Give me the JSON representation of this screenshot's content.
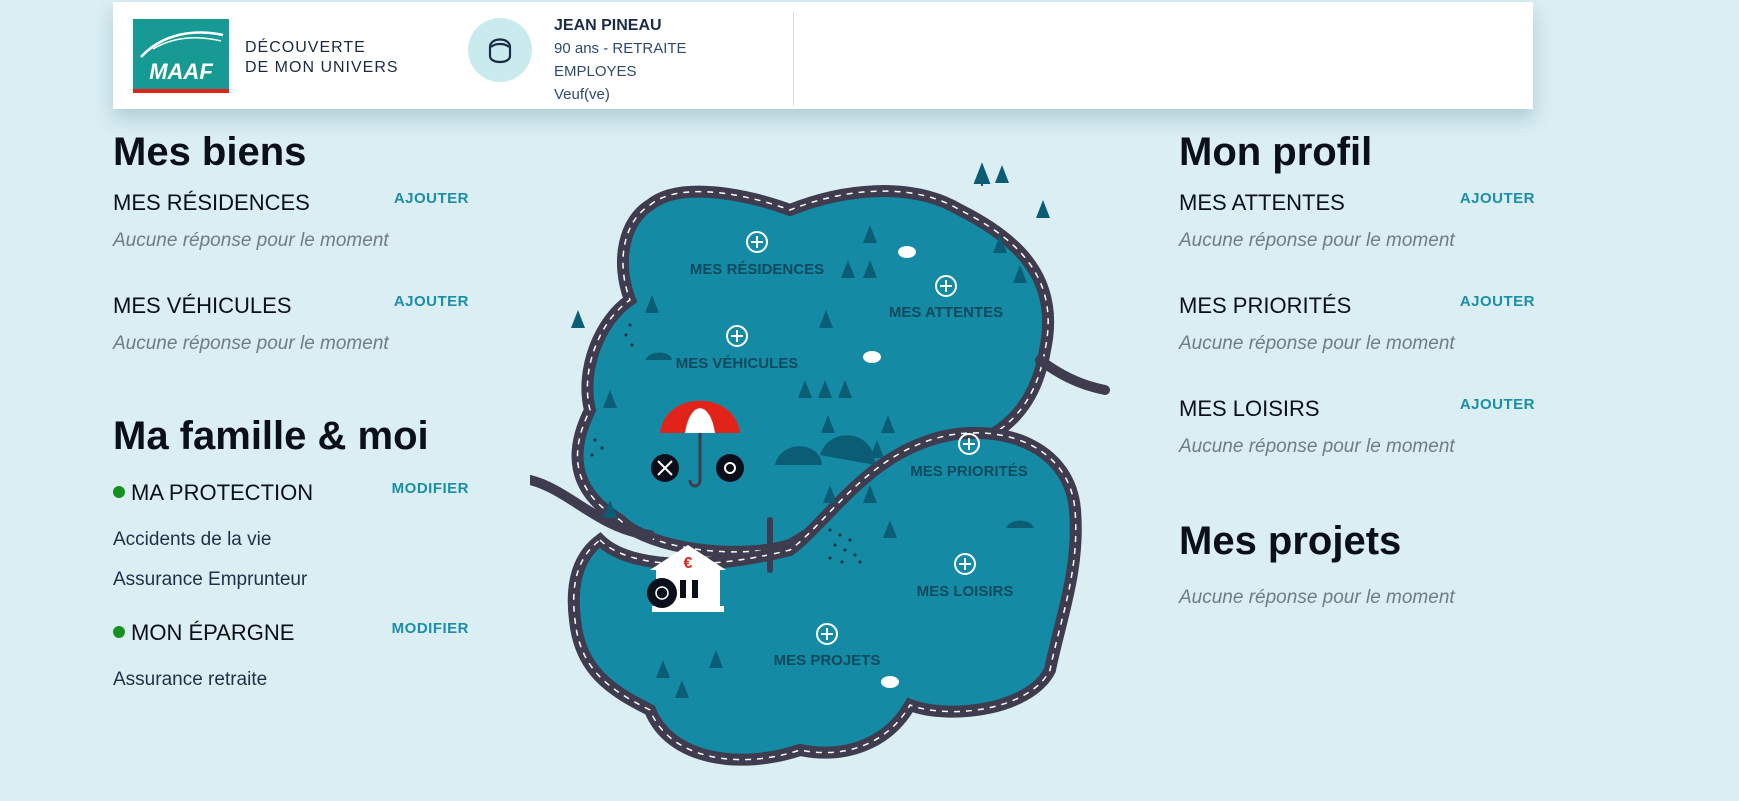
{
  "header": {
    "logo_text": "MAAF",
    "brand_line1": "DÉCOUVERTE",
    "brand_line2": "DE MON UNIVERS",
    "user": {
      "name": "JEAN PINEAU",
      "age_status": "90 ans - RETRAITE",
      "category": "EMPLOYES",
      "marital": "Veuf(ve)"
    }
  },
  "left": {
    "biens_title": "Mes biens",
    "residences": {
      "title": "MES RÉSIDENCES",
      "action": "AJOUTER",
      "empty": "Aucune réponse pour le moment"
    },
    "vehicules": {
      "title": "MES VÉHICULES",
      "action": "AJOUTER",
      "empty": "Aucune réponse pour le moment"
    },
    "famille_title": "Ma famille & moi",
    "protection": {
      "title": "MA PROTECTION",
      "action": "MODIFIER",
      "items": [
        "Accidents de la vie",
        "Assurance Emprunteur"
      ]
    },
    "epargne": {
      "title": "MON ÉPARGNE",
      "action": "MODIFIER",
      "items": [
        "Assurance retraite"
      ]
    },
    "status_color": "#16911f"
  },
  "right": {
    "profil_title": "Mon profil",
    "attentes": {
      "title": "MES ATTENTES",
      "action": "AJOUTER",
      "empty": "Aucune réponse pour le moment"
    },
    "priorites": {
      "title": "MES PRIORITÉS",
      "action": "AJOUTER",
      "empty": "Aucune réponse pour le moment"
    },
    "loisirs": {
      "title": "MES LOISIRS",
      "action": "AJOUTER",
      "empty": "Aucune réponse pour le moment"
    },
    "projets_title": "Mes projets",
    "projets_empty": "Aucune réponse pour le moment"
  },
  "map": {
    "residences": "MES RÉSIDENCES",
    "vehicules": "MES VÉHICULES",
    "attentes": "MES ATTENTES",
    "priorites": "MES PRIORITÉS",
    "loisirs": "MES LOISIRS",
    "projets": "MES PROJETS",
    "bank_symbol": "€",
    "land_color": "#148aa4",
    "road_color": "#3e3c4e",
    "tree_color": "#0b5d76"
  },
  "colors": {
    "accent": "#1a8fa5",
    "background": "#daeef3"
  }
}
